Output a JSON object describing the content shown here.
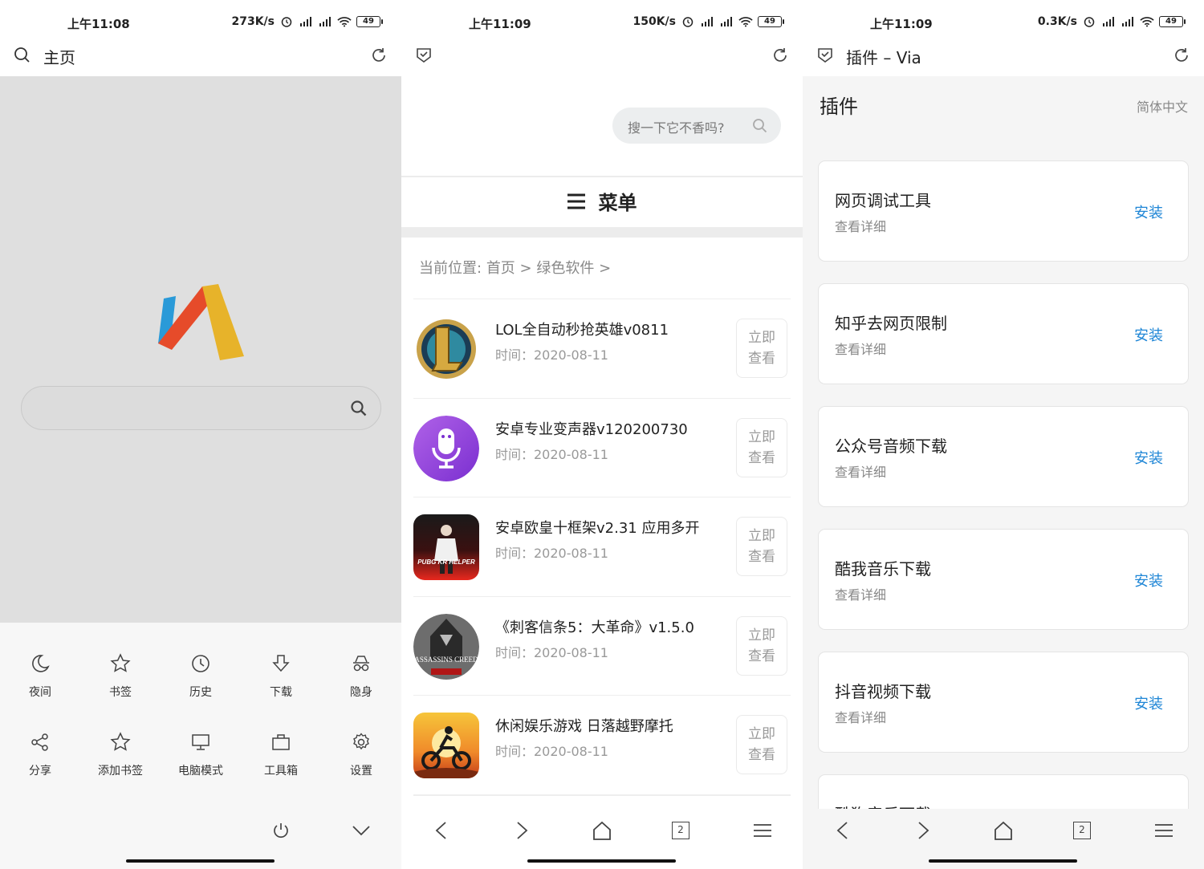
{
  "panels": [
    {
      "status": {
        "time": "上午11:08",
        "speed": "273K/s",
        "battery": "49"
      },
      "address_bar": {
        "title": "主页"
      },
      "menu": [
        {
          "label": "夜间",
          "icon": "moon-icon"
        },
        {
          "label": "书签",
          "icon": "star-icon"
        },
        {
          "label": "历史",
          "icon": "clock-icon"
        },
        {
          "label": "下载",
          "icon": "download-icon"
        },
        {
          "label": "隐身",
          "icon": "incognito-icon"
        },
        {
          "label": "分享",
          "icon": "share-icon"
        },
        {
          "label": "添加书签",
          "icon": "star-plus-icon"
        },
        {
          "label": "电脑模式",
          "icon": "monitor-icon"
        },
        {
          "label": "工具箱",
          "icon": "toolbox-icon"
        },
        {
          "label": "设置",
          "icon": "gear-icon"
        }
      ]
    },
    {
      "status": {
        "time": "上午11:09",
        "speed": "150K/s",
        "battery": "49"
      },
      "search": {
        "placeholder": "搜一下它不香吗?"
      },
      "menu_label": "菜单",
      "breadcrumb": {
        "prefix": "当前位置:",
        "home": "首页",
        "sep1": ">",
        "category": "绿色软件",
        "sep2": ">"
      },
      "items": [
        {
          "title": "LOL全自动秒抢英雄v0811",
          "time": "时间：2020-08-11",
          "btn1": "立即",
          "btn2": "查看",
          "thumb": "lol-logo-icon"
        },
        {
          "title": "安卓专业变声器v120200730",
          "time": "时间：2020-08-11",
          "btn1": "立即",
          "btn2": "查看",
          "thumb": "microphone-icon"
        },
        {
          "title": "安卓欧皇十框架v2.31 应用多开",
          "time": "时间：2020-08-11",
          "btn1": "立即",
          "btn2": "查看",
          "thumb": "pubg-helper-icon",
          "thumb_text": "PUBG KR HELPER"
        },
        {
          "title": "《刺客信条5：大革命》v1.5.0",
          "time": "时间：2020-08-11",
          "btn1": "立即",
          "btn2": "查看",
          "thumb": "assassins-creed-icon",
          "thumb_text": "ASSASSINS CREED"
        },
        {
          "title": "休闲娱乐游戏 日落越野摩托",
          "time": "时间：2020-08-11",
          "btn1": "立即",
          "btn2": "查看",
          "thumb": "motorbike-icon"
        }
      ],
      "nav": {
        "tab_count": "2"
      }
    },
    {
      "status": {
        "time": "上午11:09",
        "speed": "0.3K/s",
        "battery": "49"
      },
      "address_bar": {
        "title": "插件 – Via"
      },
      "header": {
        "title": "插件",
        "language": "简体中文"
      },
      "plugins": [
        {
          "name": "网页调试工具",
          "detail": "查看详细",
          "action": "安装"
        },
        {
          "name": "知乎去网页限制",
          "detail": "查看详细",
          "action": "安装"
        },
        {
          "name": "公众号音频下载",
          "detail": "查看详细",
          "action": "安装"
        },
        {
          "name": "酷我音乐下载",
          "detail": "查看详细",
          "action": "安装"
        },
        {
          "name": "抖音视频下载",
          "detail": "查看详细",
          "action": "安装"
        },
        {
          "name": "酷狗音乐下载",
          "detail": "",
          "action": ""
        }
      ],
      "nav": {
        "tab_count": "2"
      }
    }
  ],
  "colors": {
    "accent_blue": "#1f86d6",
    "logo_blue": "#2a9ad8",
    "logo_red": "#e64b2a",
    "logo_yellow": "#e7b32a"
  }
}
